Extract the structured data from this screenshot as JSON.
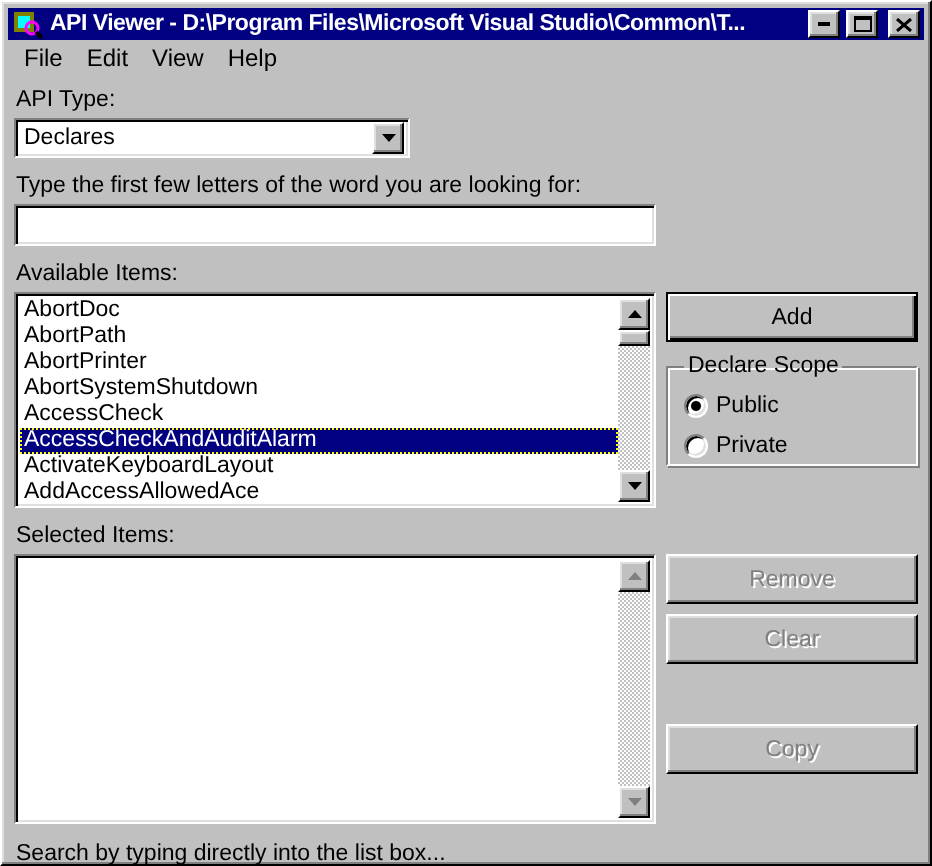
{
  "window": {
    "title": "API Viewer - D:\\Program Files\\Microsoft Visual Studio\\Common\\T...",
    "controls": [
      {
        "kind": "minimize"
      },
      {
        "kind": "maximize"
      },
      {
        "kind": "close"
      }
    ]
  },
  "menu": [
    "File",
    "Edit",
    "View",
    "Help"
  ],
  "api_type": {
    "label": "API Type:",
    "value": "Declares"
  },
  "search": {
    "label": "Type the first few letters of the word you are looking for:"
  },
  "available": {
    "label": "Available Items:",
    "items": [
      {
        "text": "AbortDoc",
        "selected": false
      },
      {
        "text": "AbortPath",
        "selected": false
      },
      {
        "text": "AbortPrinter",
        "selected": false
      },
      {
        "text": "AbortSystemShutdown",
        "selected": false
      },
      {
        "text": "AccessCheck",
        "selected": false
      },
      {
        "text": "AccessCheckAndAuditAlarm",
        "selected": true
      },
      {
        "text": "ActivateKeyboardLayout",
        "selected": false
      },
      {
        "text": "AddAccessAllowedAce",
        "selected": false
      }
    ]
  },
  "add_button": {
    "label": "Add",
    "disabled": false
  },
  "declare_scope": {
    "title": "Declare Scope",
    "options": [
      {
        "label": "Public",
        "selected": true
      },
      {
        "label": "Private",
        "selected": false
      }
    ]
  },
  "selected_items": {
    "label": "Selected Items:"
  },
  "buttons": [
    {
      "label": "Remove",
      "disabled": true
    },
    {
      "label": "Clear",
      "disabled": true
    },
    {
      "label": "Copy",
      "disabled": true
    }
  ],
  "status": "Search by typing directly into the list box..."
}
